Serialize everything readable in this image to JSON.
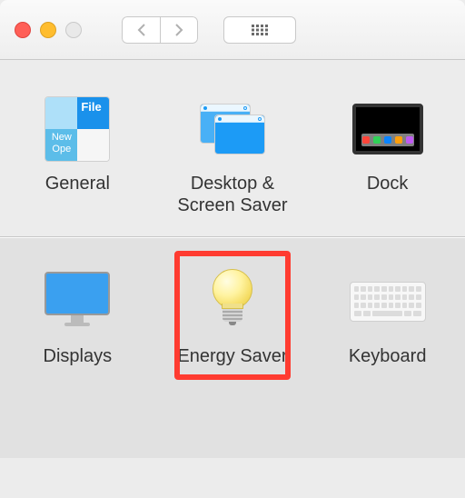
{
  "items": {
    "general": {
      "label": "General",
      "file_tag": "File",
      "menu_lines": "New\nOpe"
    },
    "desktop_screensaver": {
      "label": "Desktop & Screen Saver"
    },
    "dock": {
      "label": "Dock"
    },
    "displays": {
      "label": "Displays"
    },
    "energy_saver": {
      "label": "Energy Saver"
    },
    "keyboard": {
      "label": "Keyboard"
    }
  },
  "highlighted_item": "energy_saver"
}
